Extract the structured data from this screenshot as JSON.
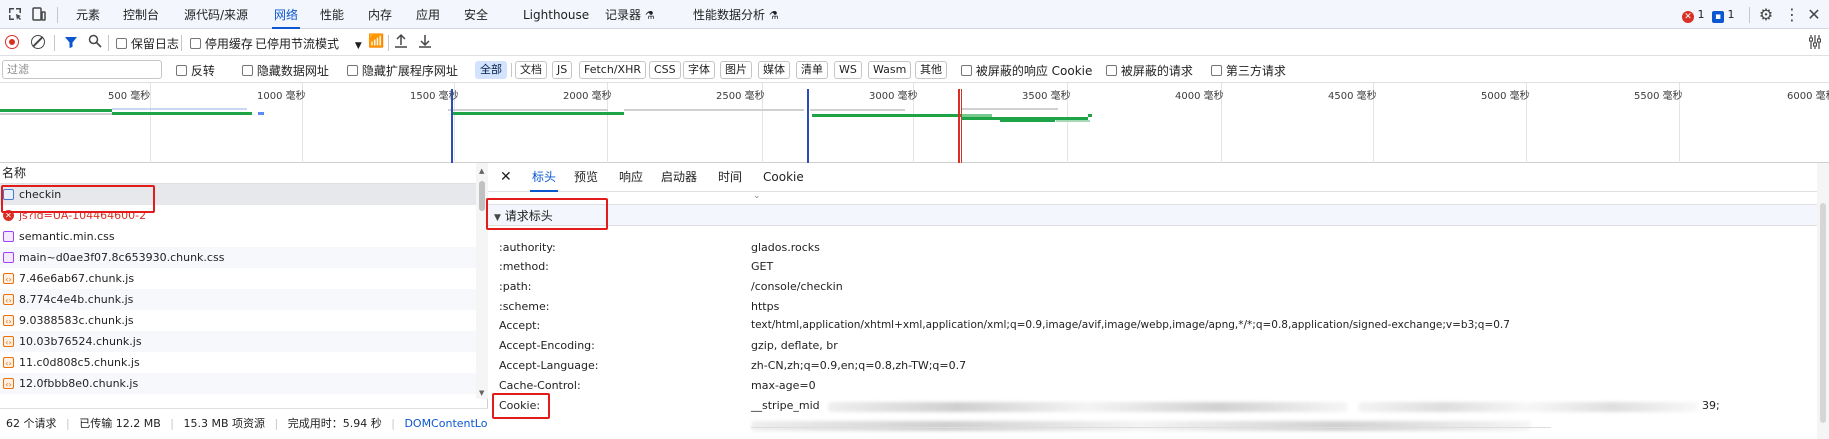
{
  "tabs": {
    "elements": "元素",
    "console": "控制台",
    "sources": "源代码/来源",
    "network": "网络",
    "performance": "性能",
    "memory": "内存",
    "application": "应用",
    "security": "安全",
    "lighthouse": "Lighthouse",
    "recorder": "记录器",
    "perf_insights": "性能数据分析",
    "error_count": "1",
    "message_count": "1"
  },
  "toolbar": {
    "preserve_log": "保留日志",
    "disable_cache": "停用缓存",
    "throttle": "已停用节流模式"
  },
  "filter": {
    "placeholder": "过滤",
    "invert": "反转",
    "hide_data_urls": "隐藏数据网址",
    "hide_ext_urls": "隐藏扩展程序网址",
    "types": [
      "全部",
      "文档",
      "JS",
      "Fetch/XHR",
      "CSS",
      "字体",
      "图片",
      "媒体",
      "清单",
      "WS",
      "Wasm",
      "其他"
    ],
    "blocked_cookies": "被屏蔽的响应 Cookie",
    "blocked_requests": "被屏蔽的请求",
    "third_party": "第三方请求"
  },
  "overview": {
    "ticks": [
      "500 毫秒",
      "1000 毫秒",
      "1500 毫秒",
      "2000 毫秒",
      "2500 毫秒",
      "3000 毫秒",
      "3500 毫秒",
      "4000 毫秒",
      "4500 毫秒",
      "5000 毫秒",
      "5500 毫秒",
      "6000 毫秒"
    ]
  },
  "request_list": {
    "header": "名称",
    "rows": [
      {
        "name": "checkin",
        "type": "doc",
        "error": false
      },
      {
        "name": "js?id=UA-104464600-2",
        "type": "error",
        "error": true
      },
      {
        "name": "semantic.min.css",
        "type": "css",
        "error": false
      },
      {
        "name": "main~d0ae3f07.8c653930.chunk.css",
        "type": "css",
        "error": false
      },
      {
        "name": "7.46e6ab67.chunk.js",
        "type": "js",
        "error": false
      },
      {
        "name": "8.774c4e4b.chunk.js",
        "type": "js",
        "error": false
      },
      {
        "name": "9.0388583c.chunk.js",
        "type": "js",
        "error": false
      },
      {
        "name": "10.03b76524.chunk.js",
        "type": "js",
        "error": false
      },
      {
        "name": "11.c0d808c5.chunk.js",
        "type": "js",
        "error": false
      },
      {
        "name": "12.0fbbb8e0.chunk.js",
        "type": "js",
        "error": false
      }
    ]
  },
  "status": {
    "requests": "62 个请求",
    "transferred": "已传输 12.2 MB",
    "resources": "15.3 MB 项资源",
    "finish": "完成用时：5.94 秒",
    "dcl": "DOMContentLoa"
  },
  "detail_tabs": [
    "标头",
    "预览",
    "响应",
    "启动器",
    "时间",
    "Cookie"
  ],
  "request_headers": {
    "section_title": "请求标头",
    "rows": [
      {
        "key": ":authority:",
        "value": "glados.rocks"
      },
      {
        "key": ":method:",
        "value": "GET"
      },
      {
        "key": ":path:",
        "value": "/console/checkin"
      },
      {
        "key": ":scheme:",
        "value": "https"
      },
      {
        "key": "Accept:",
        "value": "text/html,application/xhtml+xml,application/xml;q=0.9,image/avif,image/webp,image/apng,*/*;q=0.8,application/signed-exchange;v=b3;q=0.7"
      },
      {
        "key": "Accept-Encoding:",
        "value": "gzip, deflate, br"
      },
      {
        "key": "Accept-Language:",
        "value": "zh-CN,zh;q=0.9,en;q=0.8,zh-TW;q=0.7"
      },
      {
        "key": "Cache-Control:",
        "value": "max-age=0"
      },
      {
        "key": "Cookie:",
        "value": "__stripe_mid"
      }
    ],
    "cookie_tail": "39;"
  },
  "colors": {
    "accent": "#0b57d0",
    "highlight": "#e21b1b",
    "waterfall_green": "#1ea446",
    "error": "#d93025"
  }
}
